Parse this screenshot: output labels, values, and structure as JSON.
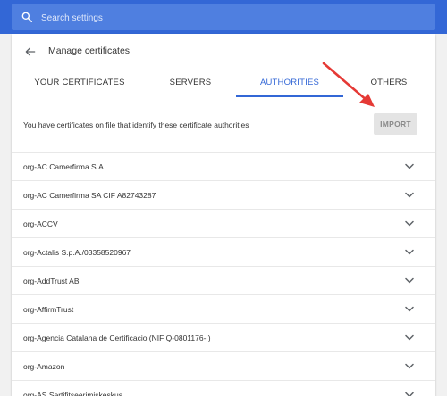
{
  "search": {
    "placeholder": "Search settings",
    "icon": "search-icon"
  },
  "header": {
    "title": "Manage certificates",
    "back_icon": "arrow-back-icon"
  },
  "tabs": [
    {
      "label": "YOUR CERTIFICATES",
      "active": false
    },
    {
      "label": "SERVERS",
      "active": false
    },
    {
      "label": "AUTHORITIES",
      "active": true
    },
    {
      "label": "OTHERS",
      "active": false
    }
  ],
  "authorities": {
    "description": "You have certificates on file that identify these certificate authorities",
    "import_label": "IMPORT",
    "items": [
      "org-AC Camerfirma S.A.",
      "org-AC Camerfirma SA CIF A82743287",
      "org-ACCV",
      "org-Actalis S.p.A./03358520967",
      "org-AddTrust AB",
      "org-AffirmTrust",
      "org-Agencia Catalana de Certificacio (NIF Q-0801176-I)",
      "org-Amazon",
      "org-AS Sertifitseerimiskeskus"
    ]
  },
  "colors": {
    "topbar": "#3367d6",
    "accent": "#3367d6",
    "annotation_arrow": "#e53935"
  }
}
